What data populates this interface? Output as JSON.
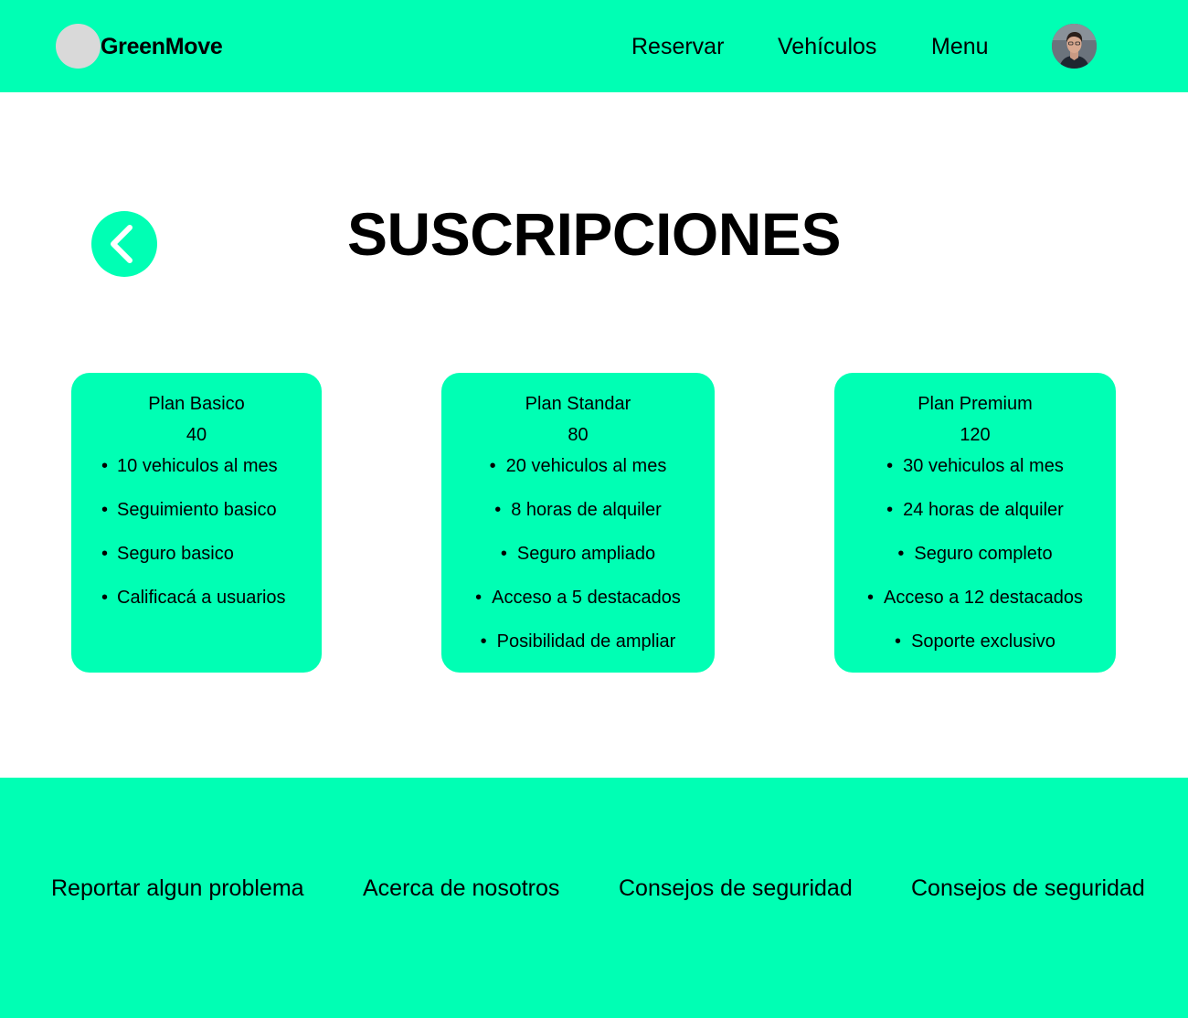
{
  "header": {
    "brand": "GreenMove",
    "nav": [
      "Reservar",
      "Vehículos",
      "Menu"
    ]
  },
  "page": {
    "title": "SUSCRIPCIONES"
  },
  "plans": [
    {
      "name": "Plan Basico",
      "price": "40",
      "features": [
        "10 vehiculos al mes",
        "Seguimiento basico",
        "Seguro basico",
        "Calificacá a usuarios"
      ]
    },
    {
      "name": "Plan Standar",
      "price": "80",
      "features": [
        "20 vehiculos al mes",
        "8 horas de alquiler",
        "Seguro ampliado",
        "Acceso a 5 destacados",
        "Posibilidad de ampliar"
      ]
    },
    {
      "name": "Plan Premium",
      "price": "120",
      "features": [
        "30 vehiculos al mes",
        "24 horas de alquiler",
        "Seguro completo",
        "Acceso a 12 destacados",
        "Soporte exclusivo"
      ]
    }
  ],
  "footer": {
    "links": [
      "Reportar algun problema",
      "Acerca de nosotros",
      "Consejos de seguridad",
      "Consejos de seguridad"
    ]
  },
  "colors": {
    "accent": "#00ffb4",
    "logo_placeholder": "#d9d9d9",
    "text": "#000000",
    "background": "#ffffff"
  },
  "icons": {
    "back": "chevron-left-icon",
    "avatar": "user-avatar"
  }
}
